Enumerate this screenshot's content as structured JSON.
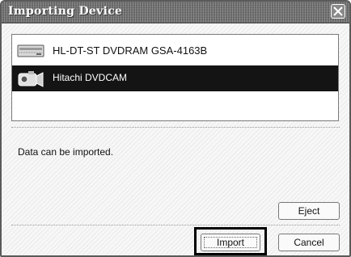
{
  "window": {
    "title": "Importing Device"
  },
  "devices": [
    {
      "label": "HL-DT-ST DVDRAM GSA-4163B",
      "icon": "dvd-drive-icon",
      "selected": false
    },
    {
      "label": "Hitachi DVDCAM",
      "icon": "camcorder-icon",
      "selected": true
    }
  ],
  "status": {
    "message": "Data can be imported."
  },
  "buttons": {
    "eject": "Eject",
    "import": "Import",
    "cancel": "Cancel"
  },
  "colors": {
    "selection": "#141414",
    "title_bar": "#6f6f6f",
    "highlight": "#000000"
  }
}
